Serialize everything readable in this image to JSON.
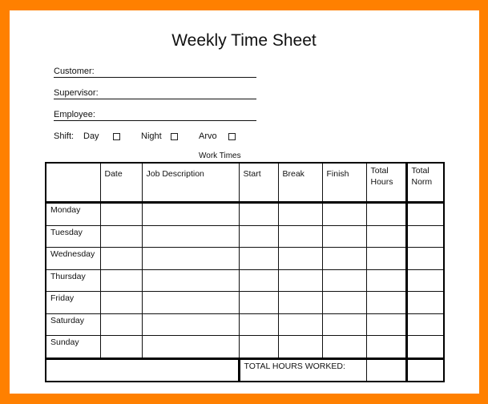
{
  "title": "Weekly Time Sheet",
  "fields": {
    "customer_label": "Customer:",
    "supervisor_label": "Supervisor:",
    "employee_label": "Employee:"
  },
  "shift": {
    "label": "Shift:",
    "options": [
      {
        "label": "Day",
        "checked": false
      },
      {
        "label": "Night",
        "checked": false
      },
      {
        "label": "Arvo",
        "checked": false
      }
    ]
  },
  "table": {
    "group_label": "Work Times",
    "columns": [
      "",
      "Date",
      "Job Description",
      "Start",
      "Break",
      "Finish",
      "Total Hours",
      "Total Norm"
    ],
    "rows": [
      "Monday",
      "Tuesday",
      "Wednesday",
      "Thursday",
      "Friday",
      "Saturday",
      "Sunday"
    ],
    "total_label": "TOTAL HOURS WORKED:"
  },
  "colors": {
    "frame": "#ff8000",
    "paper": "#ffffff",
    "ink": "#111111"
  }
}
